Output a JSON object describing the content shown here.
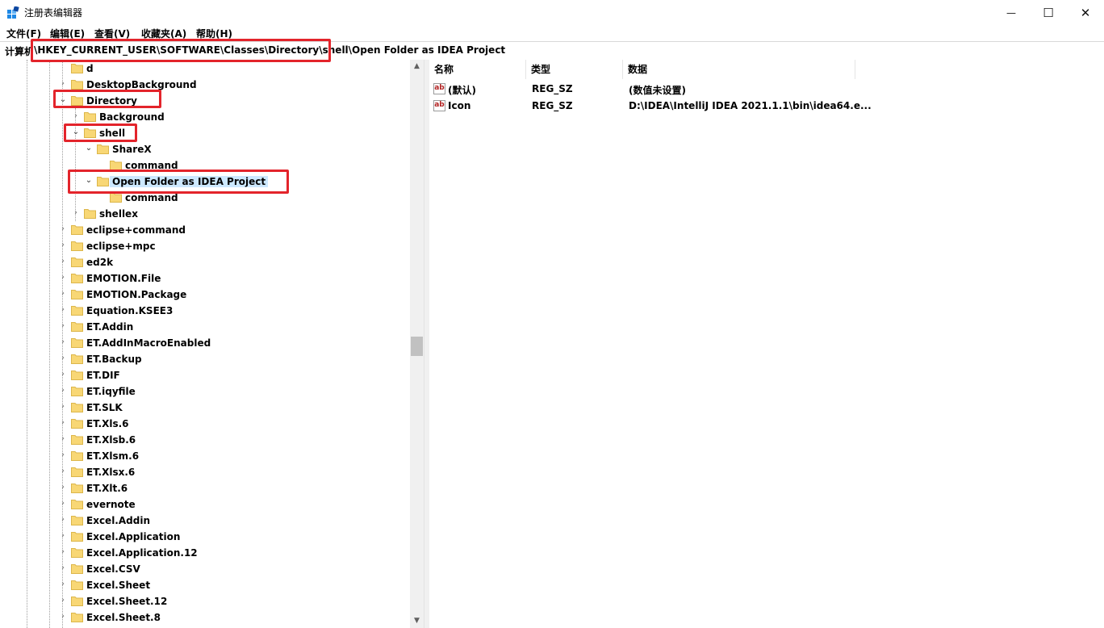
{
  "window": {
    "title": "注册表编辑器",
    "minimize_glyph": "—",
    "maximize_glyph": "☐",
    "close_glyph": "✕"
  },
  "menu": [
    "文件(F)",
    "编辑(E)",
    "查看(V)",
    "收藏夹(A)",
    "帮助(H)"
  ],
  "address": {
    "label": "计算机",
    "path": "\\HKEY_CURRENT_USER\\SOFTWARE\\Classes\\Directory\\shell\\Open Folder as IDEA Project"
  },
  "tree": [
    {
      "name": "d",
      "depth": 0,
      "expander": "none"
    },
    {
      "name": "DesktopBackground",
      "depth": 0,
      "expander": "collapsed"
    },
    {
      "name": "Directory",
      "depth": 0,
      "expander": "expanded"
    },
    {
      "name": "Background",
      "depth": 1,
      "expander": "collapsed"
    },
    {
      "name": "shell",
      "depth": 1,
      "expander": "expanded"
    },
    {
      "name": "ShareX",
      "depth": 2,
      "expander": "expanded"
    },
    {
      "name": "command",
      "depth": 3,
      "expander": "none"
    },
    {
      "name": "Open Folder as IDEA Project",
      "depth": 2,
      "expander": "expanded",
      "selected": true
    },
    {
      "name": "command",
      "depth": 3,
      "expander": "none"
    },
    {
      "name": "shellex",
      "depth": 1,
      "expander": "collapsed"
    },
    {
      "name": "eclipse+command",
      "depth": 0,
      "expander": "collapsed"
    },
    {
      "name": "eclipse+mpc",
      "depth": 0,
      "expander": "collapsed"
    },
    {
      "name": "ed2k",
      "depth": 0,
      "expander": "collapsed"
    },
    {
      "name": "EMOTION.File",
      "depth": 0,
      "expander": "collapsed"
    },
    {
      "name": "EMOTION.Package",
      "depth": 0,
      "expander": "collapsed"
    },
    {
      "name": "Equation.KSEE3",
      "depth": 0,
      "expander": "collapsed"
    },
    {
      "name": "ET.Addin",
      "depth": 0,
      "expander": "collapsed"
    },
    {
      "name": "ET.AddInMacroEnabled",
      "depth": 0,
      "expander": "collapsed"
    },
    {
      "name": "ET.Backup",
      "depth": 0,
      "expander": "collapsed"
    },
    {
      "name": "ET.DIF",
      "depth": 0,
      "expander": "collapsed"
    },
    {
      "name": "ET.iqyfile",
      "depth": 0,
      "expander": "collapsed"
    },
    {
      "name": "ET.SLK",
      "depth": 0,
      "expander": "collapsed"
    },
    {
      "name": "ET.Xls.6",
      "depth": 0,
      "expander": "collapsed"
    },
    {
      "name": "ET.Xlsb.6",
      "depth": 0,
      "expander": "collapsed"
    },
    {
      "name": "ET.Xlsm.6",
      "depth": 0,
      "expander": "collapsed"
    },
    {
      "name": "ET.Xlsx.6",
      "depth": 0,
      "expander": "collapsed"
    },
    {
      "name": "ET.Xlt.6",
      "depth": 0,
      "expander": "collapsed"
    },
    {
      "name": "evernote",
      "depth": 0,
      "expander": "collapsed"
    },
    {
      "name": "Excel.Addin",
      "depth": 0,
      "expander": "collapsed"
    },
    {
      "name": "Excel.Application",
      "depth": 0,
      "expander": "collapsed"
    },
    {
      "name": "Excel.Application.12",
      "depth": 0,
      "expander": "collapsed"
    },
    {
      "name": "Excel.CSV",
      "depth": 0,
      "expander": "collapsed"
    },
    {
      "name": "Excel.Sheet",
      "depth": 0,
      "expander": "collapsed"
    },
    {
      "name": "Excel.Sheet.12",
      "depth": 0,
      "expander": "collapsed"
    },
    {
      "name": "Excel.Sheet.8",
      "depth": 0,
      "expander": "collapsed"
    }
  ],
  "values": {
    "columns": [
      "名称",
      "类型",
      "数据"
    ],
    "rows": [
      {
        "name": "(默认)",
        "type": "REG_SZ",
        "data": "(数值未设置)",
        "icon": "string-value-icon"
      },
      {
        "name": "Icon",
        "type": "REG_SZ",
        "data": "D:\\IDEA\\IntelliJ IDEA 2021.1.1\\bin\\idea64.e...",
        "icon": "string-value-icon"
      }
    ]
  },
  "icon_glyphs": {
    "string_value": "ab",
    "collapsed": "›",
    "expanded": "⌄",
    "scroll_up": "▲",
    "scroll_down": "▼"
  },
  "colors": {
    "highlight_box": "#e3242b",
    "selection": "#cce8ff",
    "folder": "#f8d775",
    "folder_edge": "#dcb64a"
  }
}
